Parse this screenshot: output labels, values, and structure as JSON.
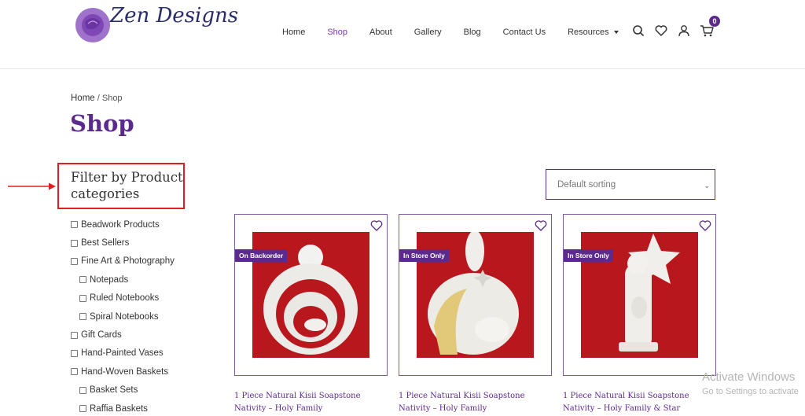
{
  "header": {
    "logo_text": "Zen Designs",
    "nav": [
      {
        "label": "Home"
      },
      {
        "label": "Shop"
      },
      {
        "label": "About"
      },
      {
        "label": "Gallery"
      },
      {
        "label": "Blog"
      },
      {
        "label": "Contact Us"
      },
      {
        "label": "Resources"
      }
    ],
    "active_nav": "Shop",
    "icons": [
      "search-icon",
      "heart-icon",
      "user-icon",
      "cart-icon"
    ],
    "cart_count": "0"
  },
  "breadcrumb": {
    "home": "Home",
    "separator": " / ",
    "current": "Shop"
  },
  "page_title": "Shop",
  "sidebar": {
    "filter_title": "Filter by Product categories",
    "categories": [
      {
        "label": "Beadwork Products",
        "sub": false
      },
      {
        "label": "Best Sellers",
        "sub": false
      },
      {
        "label": "Fine Art & Photography",
        "sub": false
      },
      {
        "label": "Notepads",
        "sub": true
      },
      {
        "label": "Ruled Notebooks",
        "sub": true
      },
      {
        "label": "Spiral Notebooks",
        "sub": true
      },
      {
        "label": "Gift Cards",
        "sub": false
      },
      {
        "label": "Hand-Painted Vases",
        "sub": false
      },
      {
        "label": "Hand-Woven Baskets",
        "sub": false
      },
      {
        "label": "Basket Sets",
        "sub": true
      },
      {
        "label": "Raffia Baskets",
        "sub": true
      }
    ]
  },
  "sorting": {
    "selected": "Default sorting"
  },
  "products": [
    {
      "tag": "On Backorder",
      "title_line1": "1 Piece Natural Kisii Soapstone",
      "title_line2": "Nativity – Holy Family"
    },
    {
      "tag": "In Store Only",
      "title_line1": "1 Piece Natural Kisii Soapstone",
      "title_line2": "Nativity – Holy Family"
    },
    {
      "tag": "In Store Only",
      "title_line1": "1 Piece Natural Kisii Soapstone",
      "title_line2": "Nativity – Holy Family & Star"
    }
  ],
  "watermark": {
    "line1": "Activate Windows",
    "line2": "Go to Settings to activate"
  },
  "colors": {
    "brand": "#5c2a8d",
    "highlight": "#e11d1d",
    "product_bg": "#b8171d"
  }
}
